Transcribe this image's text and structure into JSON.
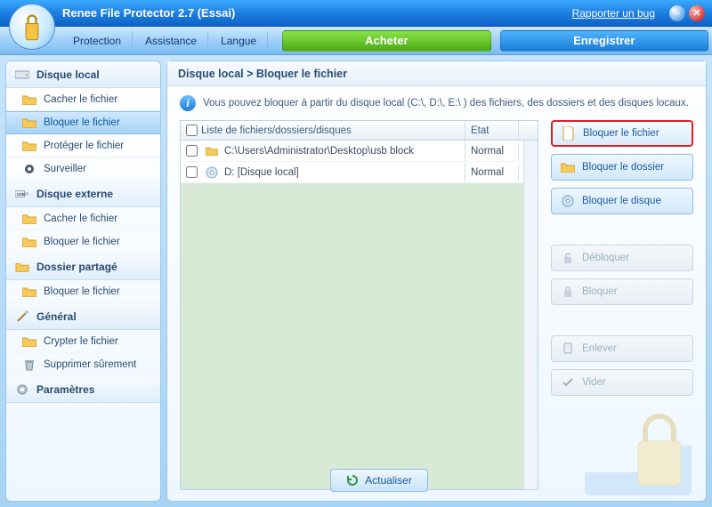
{
  "app": {
    "title": "Renee File Protector 2.7 (Essai)",
    "report_bug": "Rapporter un bug"
  },
  "menu": {
    "protection": "Protection",
    "assistance": "Assistance",
    "langue": "Langue"
  },
  "topButtons": {
    "buy": "Acheter",
    "register": "Enregistrer"
  },
  "sidebar": {
    "local_header": "Disque local",
    "local_items": [
      "Cacher le fichier",
      "Bloquer le fichier",
      "Protéger le fichier",
      "Surveiller"
    ],
    "external_header": "Disque externe",
    "external_items": [
      "Cacher le fichier",
      "Bloquer le fichier"
    ],
    "shared_header": "Dossier partagé",
    "shared_items": [
      "Bloquer le fichier"
    ],
    "general_header": "Général",
    "general_items": [
      "Crypter le fichier",
      "Supprimer sûrement"
    ],
    "settings_header": "Paramètres"
  },
  "content": {
    "breadcrumb": "Disque local > Bloquer le fichier",
    "info": "Vous pouvez bloquer à partir du disque local  (C:\\, D:\\, E:\\ )  des fichiers, des dossiers et des disques locaux.",
    "columns": {
      "c1": "Liste de fichiers/dossiers/disques",
      "c2": "Etat"
    },
    "rows": [
      {
        "path": "C:\\Users\\Administrator\\Desktop\\usb block",
        "type": "folder",
        "state": "Normal"
      },
      {
        "path": "D: [Disque local]",
        "type": "disk",
        "state": "Normal"
      }
    ],
    "refresh": "Actualiser"
  },
  "actions": {
    "block_file": "Bloquer le fichier",
    "block_folder": "Bloquer le dossier",
    "block_disk": "Bloquer le disque",
    "unblock": "Débloquer",
    "block": "Bloquer",
    "remove": "Enlever",
    "clear": "Vider"
  }
}
